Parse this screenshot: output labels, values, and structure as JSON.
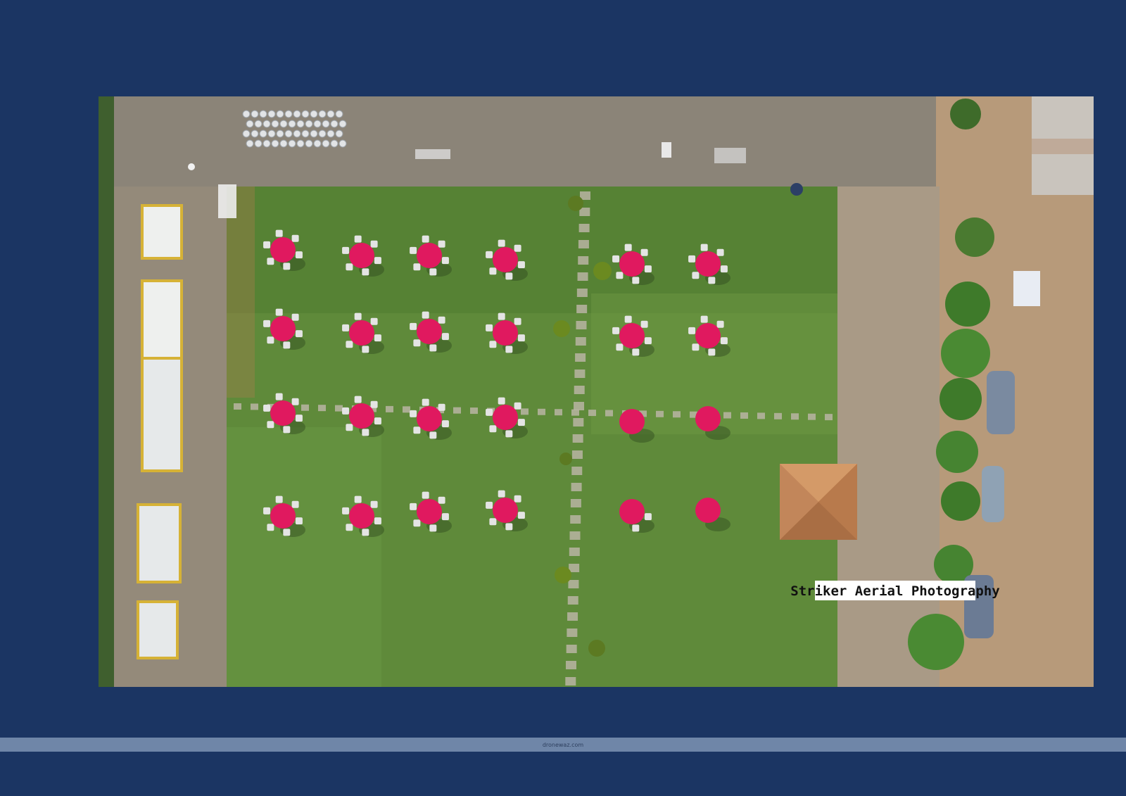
{
  "photo": {
    "watermark": "Striker Aerial Photography",
    "subject": "aerial view of outdoor event lawn with red round tables and chairs"
  },
  "footer": {
    "source_label": "dronewaz.com"
  },
  "colors": {
    "page_background": "#1b3563",
    "footer_bar": "#6f86a8",
    "lawn": "#5f8a3a",
    "tablecloth": "#e0195f",
    "path_tiles": "#b9b4a3",
    "gazebo_roof": "#c98a5a"
  }
}
